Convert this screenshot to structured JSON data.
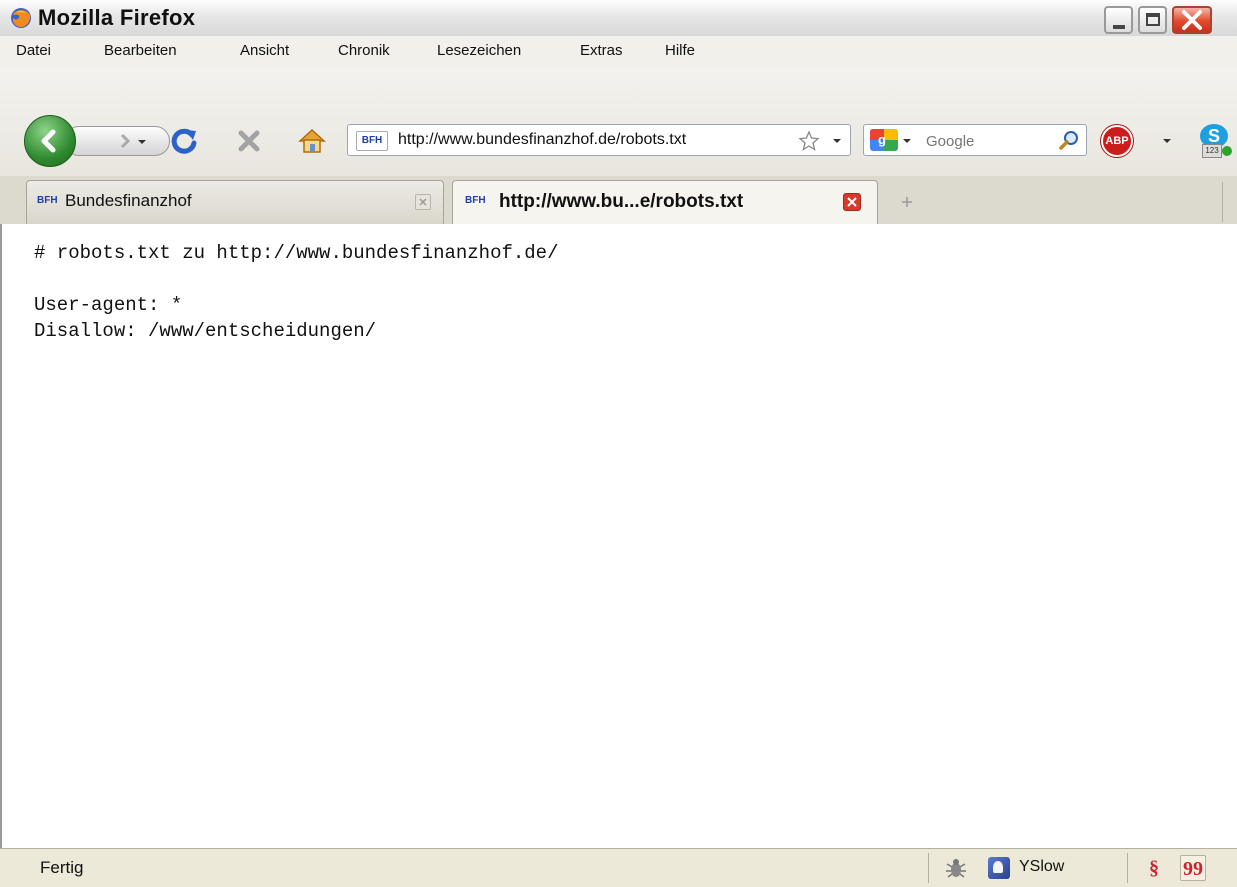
{
  "window": {
    "title": "Mozilla Firefox"
  },
  "menu": {
    "items": [
      "Datei",
      "Bearbeiten",
      "Ansicht",
      "Chronik",
      "Lesezeichen",
      "Extras",
      "Hilfe"
    ]
  },
  "navbar": {
    "url": "http://www.bundesfinanzhof.de/robots.txt",
    "search_placeholder": "Google"
  },
  "tabs": [
    {
      "label": "Bundesfinanzhof",
      "active": false
    },
    {
      "label": "http://www.bu...e/robots.txt",
      "active": true
    }
  ],
  "content": {
    "lines": [
      "# robots.txt zu http://www.bundesfinanzhof.de/",
      "",
      "User-agent: *",
      "Disallow: /www/entscheidungen/"
    ]
  },
  "status": {
    "text": "Fertig",
    "yslow_label": "YSlow"
  },
  "colors": {
    "back_button": "#2f8a2f",
    "reload": "#2a62c9",
    "abp_red": "#cc1d1d",
    "bfh_blue": "#1e3fa8"
  },
  "icons": [
    "firefox-logo-icon",
    "back-icon",
    "forward-icon",
    "dropdown-icon",
    "reload-icon",
    "stop-icon",
    "home-icon",
    "bookmark-star-icon",
    "google-icon",
    "search-icon",
    "adblock-icon",
    "skype-icon",
    "bfh-favicon-icon",
    "tab-close-icon",
    "new-tab-icon",
    "firebug-icon",
    "yslow-icon"
  ]
}
